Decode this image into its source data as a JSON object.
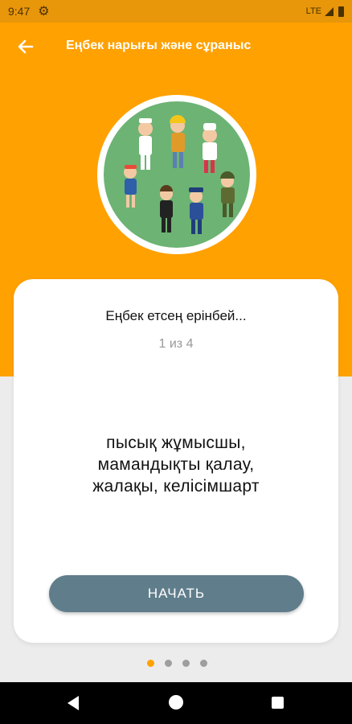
{
  "status_bar": {
    "time": "9:47",
    "network": "LTE",
    "icons": [
      "gear-icon",
      "signal-icon",
      "battery-icon"
    ]
  },
  "app_bar": {
    "title": "Еңбек нарығы және сұраныс",
    "back_icon": "arrow-left-icon"
  },
  "card": {
    "title": "Еңбек етсең ерінбей...",
    "progress": "1 из 4",
    "body_lines": [
      "пысық жұмысшы,",
      "мамандықты қалау,",
      "жалақы, келісімшарт"
    ],
    "start_label": "НАЧАТЬ"
  },
  "pager": {
    "count": 4,
    "active": 0
  },
  "colors": {
    "header": "#ffa100",
    "status": "#e8960a",
    "circle": "#6db374",
    "button": "#607d8b"
  }
}
